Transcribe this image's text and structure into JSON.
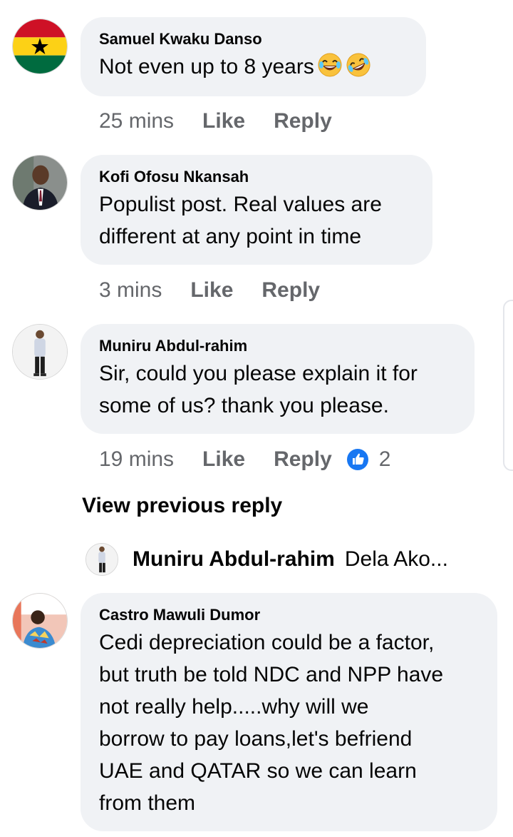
{
  "comments": [
    {
      "author": "Samuel Kwaku Danso",
      "text": "Not even up to 8 years",
      "emojis": [
        "rolling-laughing-emoji",
        "rolling-laughing-emoji"
      ],
      "time": "25 mins",
      "like_label": "Like",
      "reply_label": "Reply",
      "avatar": "ghana-flag-avatar"
    },
    {
      "author": "Kofi Ofosu Nkansah",
      "text_lines": [
        "Populist post. Real values are",
        "different at any point in time"
      ],
      "time": "3 mins",
      "like_label": "Like",
      "reply_label": "Reply",
      "avatar": "man-in-suit-avatar"
    },
    {
      "author": "Muniru Abdul-rahim",
      "text_lines": [
        "Sir, could you please explain it for",
        "some of us? thank you please."
      ],
      "time": "19 mins",
      "like_label": "Like",
      "reply_label": "Reply",
      "reaction_icon": "like-reaction-icon",
      "reaction_count": "2",
      "avatar": "standing-person-avatar"
    },
    {
      "author": "Castro Mawuli Dumor",
      "text_lines": [
        "Cedi depreciation could be a factor,",
        "but truth be told NDC and NPP have",
        "not really help.....why will we",
        "borrow to pay loans,let's befriend",
        "UAE and QATAR so we can learn",
        "from them"
      ],
      "avatar": "person-outdoors-avatar"
    }
  ],
  "view_previous_reply": "View previous reply",
  "reply_preview": {
    "author": "Muniru Abdul-rahim",
    "snippet": "Dela Ako..."
  },
  "colors": {
    "bubble": "#f0f2f5",
    "meta": "#65676b",
    "like_blue": "#1877f2"
  }
}
